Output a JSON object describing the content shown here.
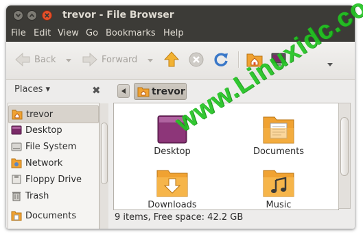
{
  "window": {
    "title": "trevor - File Browser"
  },
  "menu": [
    "File",
    "Edit",
    "View",
    "Go",
    "Bookmarks",
    "Help"
  ],
  "toolbar": {
    "back_label": "Back",
    "forward_label": "Forward"
  },
  "sidebar": {
    "header": "Places",
    "items": [
      {
        "label": "trevor",
        "icon": "home-folder-icon",
        "selected": true
      },
      {
        "label": "Desktop",
        "icon": "desktop-icon"
      },
      {
        "label": "File System",
        "icon": "drive-icon"
      },
      {
        "label": "Network",
        "icon": "network-icon"
      },
      {
        "label": "Floppy Drive",
        "icon": "floppy-icon"
      },
      {
        "label": "Trash",
        "icon": "trash-icon"
      },
      {
        "label": "Documents",
        "icon": "folder-icon"
      }
    ]
  },
  "pathbar": {
    "current": "trevor"
  },
  "files": [
    {
      "name": "Desktop",
      "icon": "desktop-folder-icon"
    },
    {
      "name": "Documents",
      "icon": "documents-folder-icon"
    },
    {
      "name": "Downloads",
      "icon": "downloads-folder-icon"
    },
    {
      "name": "Music",
      "icon": "music-folder-icon"
    }
  ],
  "status": "9 items, Free space: 42.2 GB",
  "watermark": "www.Linuxidc.com",
  "colors": {
    "titlebar": "#3c3b37",
    "close": "#e3502a",
    "folder": "#f0a232",
    "watermark": "#22c422"
  }
}
